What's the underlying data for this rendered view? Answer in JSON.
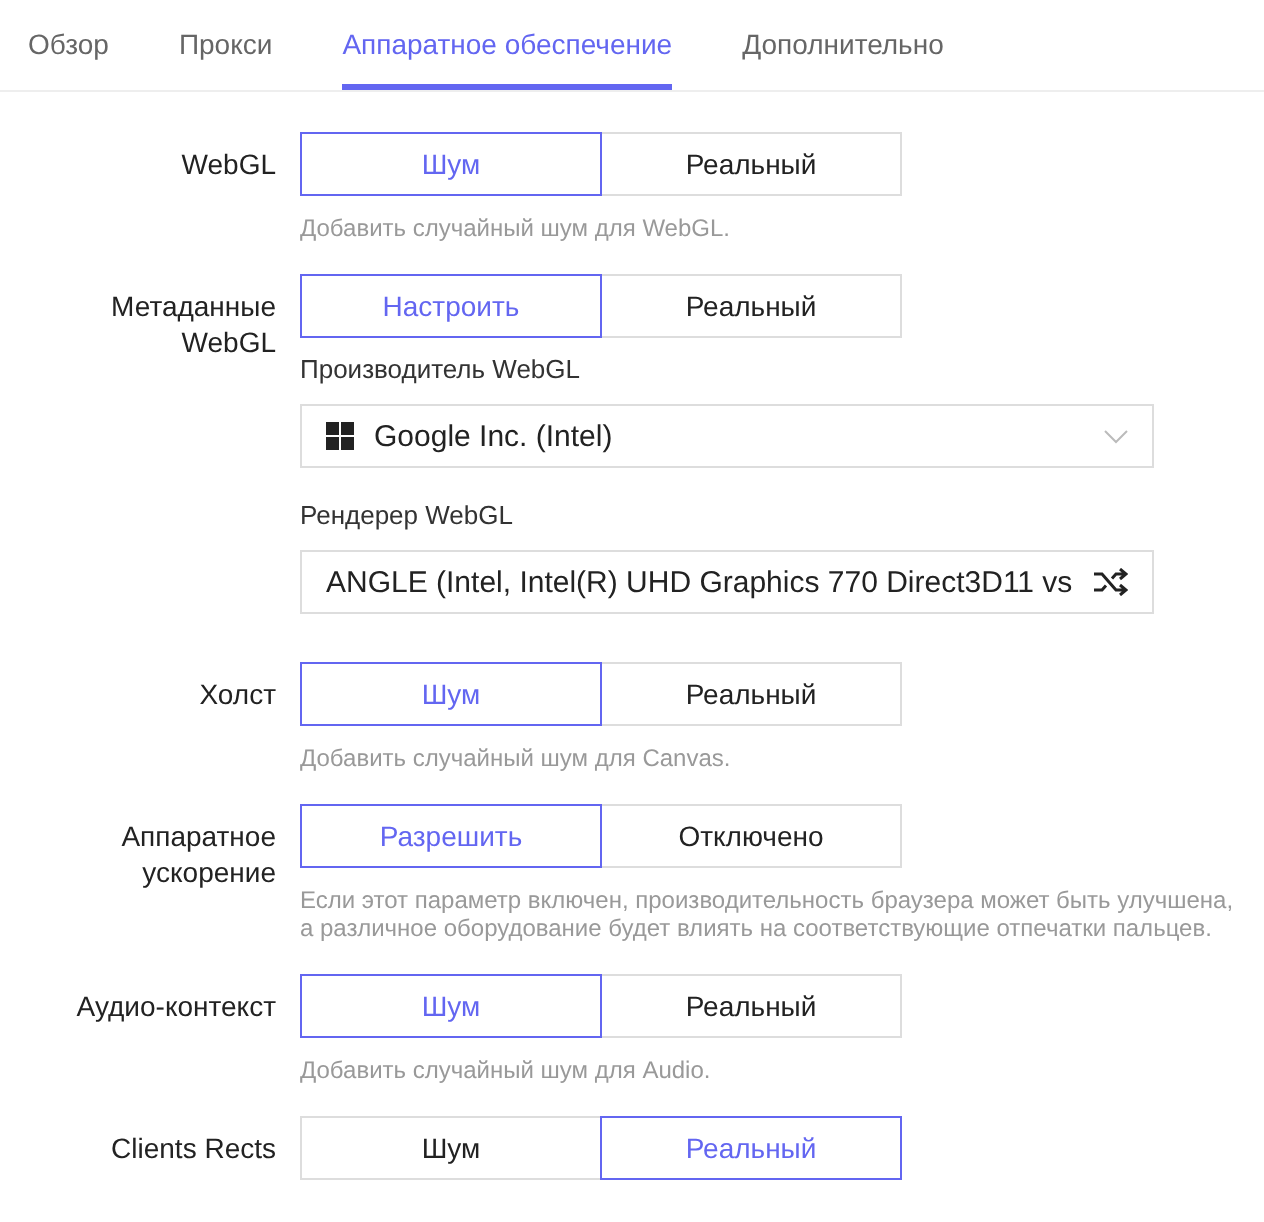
{
  "tabs": [
    {
      "label": "Обзор",
      "selected": false
    },
    {
      "label": "Прокси",
      "selected": false
    },
    {
      "label": "Аппаратное обеспечение",
      "selected": true
    },
    {
      "label": "Дополнительно",
      "selected": false
    }
  ],
  "settings": [
    {
      "label": "WebGL",
      "options": [
        {
          "label": "Шум",
          "selected": true
        },
        {
          "label": "Реальный",
          "selected": false
        }
      ],
      "hint": "Добавить случайный шум для WebGL."
    },
    {
      "label": "Метаданные WebGL",
      "options": [
        {
          "label": "Настроить",
          "selected": true
        },
        {
          "label": "Реальный",
          "selected": false
        }
      ],
      "fields": [
        {
          "kind": "select",
          "label": "Производитель WebGL",
          "value": "Google Inc. (Intel)"
        },
        {
          "kind": "input",
          "label": "Рендерер WebGL",
          "value": "ANGLE (Intel, Intel(R) UHD Graphics 770 Direct3D11 vs"
        }
      ]
    },
    {
      "label": "Холст",
      "options": [
        {
          "label": "Шум",
          "selected": true
        },
        {
          "label": "Реальный",
          "selected": false
        }
      ],
      "hint": "Добавить случайный шум для Canvas."
    },
    {
      "label": "Аппаратное ускорение",
      "options": [
        {
          "label": "Разрешить",
          "selected": true
        },
        {
          "label": "Отключено",
          "selected": false
        }
      ],
      "hint": "Если этот параметр включен, производительность браузера может быть улучшена, а различное оборудование будет влиять на соответствующие отпечатки пальцев."
    },
    {
      "label": "Аудио-контекст",
      "options": [
        {
          "label": "Шум",
          "selected": true
        },
        {
          "label": "Реальный",
          "selected": false
        }
      ],
      "hint": "Добавить случайный шум для Audio."
    },
    {
      "label": "Clients Rects",
      "options": [
        {
          "label": "Шум",
          "selected": false
        },
        {
          "label": "Реальный",
          "selected": true
        }
      ]
    }
  ]
}
